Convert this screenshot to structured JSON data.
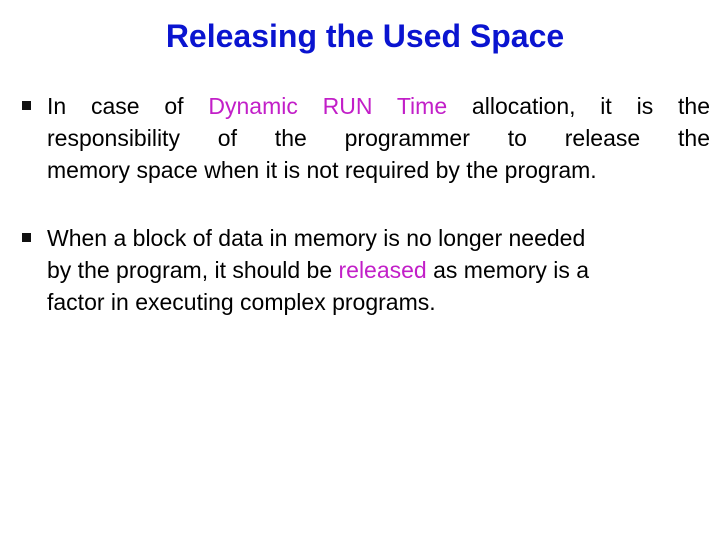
{
  "slide": {
    "title": "Releasing the Used Space",
    "accent_color": "#0a14d0",
    "highlight_color": "#c21fc8",
    "bullets": [
      {
        "lines": [
          {
            "pre": "In case of ",
            "hl": "Dynamic RUN Time",
            "post": " allocation, it is the"
          },
          {
            "text": "responsibility of the programmer to release the"
          },
          {
            "text": "memory space when it is not required by the program."
          }
        ]
      },
      {
        "lines": [
          {
            "text": "When a block of data in memory is no longer needed"
          },
          {
            "pre": "by the program, it should be ",
            "hl": "released",
            "post": " as memory is a"
          },
          {
            "text": "factor in executing complex programs."
          }
        ]
      }
    ]
  }
}
